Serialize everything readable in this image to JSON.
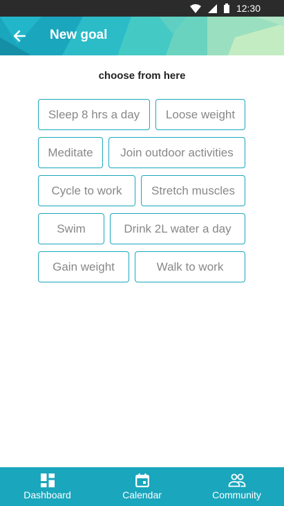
{
  "status_bar": {
    "time": "12:30",
    "icons": [
      "wifi-icon",
      "signal-icon",
      "battery-icon"
    ]
  },
  "header": {
    "title": "New goal",
    "back_icon": "arrow-left-icon",
    "accent": "#1aa6bd"
  },
  "main": {
    "subtitle": "choose from here",
    "goals": [
      "Sleep 8 hrs a day",
      "Loose weight",
      "Meditate",
      "Join outdoor activities",
      "Cycle to work",
      "Stretch muscles",
      "Swim",
      "Drink 2L water a day",
      "Gain weight",
      "Walk to work"
    ]
  },
  "bottom_nav": {
    "items": [
      {
        "label": "Dashboard",
        "icon": "dashboard-icon"
      },
      {
        "label": "Calendar",
        "icon": "calendar-icon"
      },
      {
        "label": "Community",
        "icon": "community-icon"
      }
    ]
  }
}
